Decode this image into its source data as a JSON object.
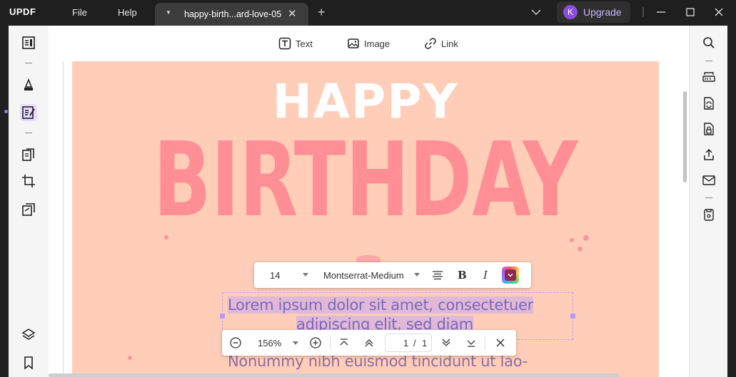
{
  "app": {
    "logo": "UPDF",
    "menu": {
      "file": "File",
      "help": "Help"
    },
    "tab": {
      "title": "happy-birth...ard-love-05"
    },
    "upgrade": {
      "avatar_initial": "K",
      "label": "Upgrade"
    }
  },
  "edit_toolbar": {
    "text_label": "Text",
    "image_label": "Image",
    "link_label": "Link"
  },
  "document": {
    "heading_small": "HAPPY",
    "heading_large": "BIRTHDAY",
    "selected_line1": "Lorem ipsum dolor sit amet, consectetuer",
    "selected_line2": "adipiscing elit, sed diam",
    "body_line3": "Nonummy nibh euismod tincidunt ut lao-"
  },
  "format_bar": {
    "font_size": "14",
    "font_family": "Montserrat-Medium",
    "bold": "B",
    "italic": "I"
  },
  "zoom_bar": {
    "zoom": "156%",
    "current_page": "1",
    "page_separator": "/",
    "total_pages": "1"
  },
  "colors": {
    "page_background": "#ffcdb8",
    "heading_large": "#ff8f95",
    "selection": "#c4aaf0",
    "accent": "#8a4de0"
  }
}
